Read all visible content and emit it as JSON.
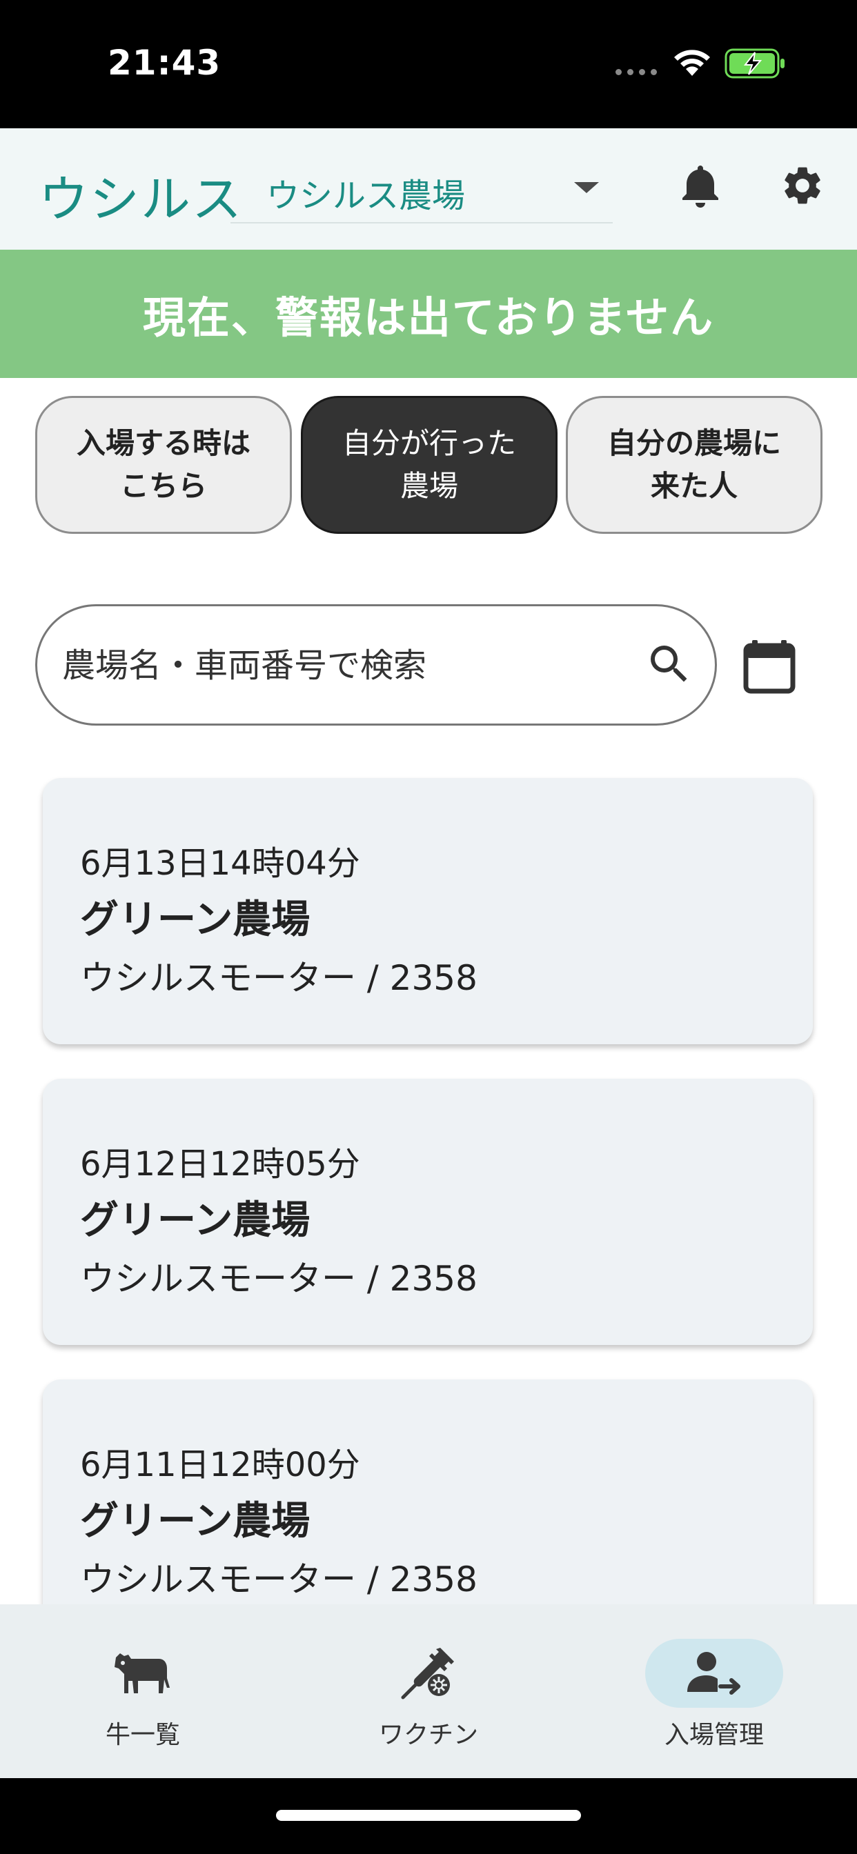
{
  "status_bar": {
    "time": "21:43"
  },
  "header": {
    "app_title": "ウシルス",
    "farm_select": "ウシルス農場"
  },
  "alert": {
    "text": "現在、警報は出ておりません"
  },
  "segments": [
    {
      "label": "入場する時は\nこちら"
    },
    {
      "label": "自分が行った\n農場"
    },
    {
      "label": "自分の農場に\n来た人"
    }
  ],
  "search": {
    "placeholder": "農場名・車両番号で検索"
  },
  "visits": [
    {
      "date": "6月13日14時04分",
      "farm": "グリーン農場",
      "vehicle": "ウシルスモーター / 2358"
    },
    {
      "date": "6月12日12時05分",
      "farm": "グリーン農場",
      "vehicle": "ウシルスモーター / 2358"
    },
    {
      "date": "6月11日12時00分",
      "farm": "グリーン農場",
      "vehicle": "ウシルスモーター / 2358"
    }
  ],
  "bottom_nav": [
    {
      "label": "牛一覧",
      "icon": "cow-icon"
    },
    {
      "label": "ワクチン",
      "icon": "syringe-icon"
    },
    {
      "label": "入場管理",
      "icon": "person-arrow-icon"
    }
  ],
  "colors": {
    "accent": "#1a8c83",
    "alert_bg": "#84c784",
    "active_segment": "#333333",
    "nav_active": "#cfe7ee"
  }
}
